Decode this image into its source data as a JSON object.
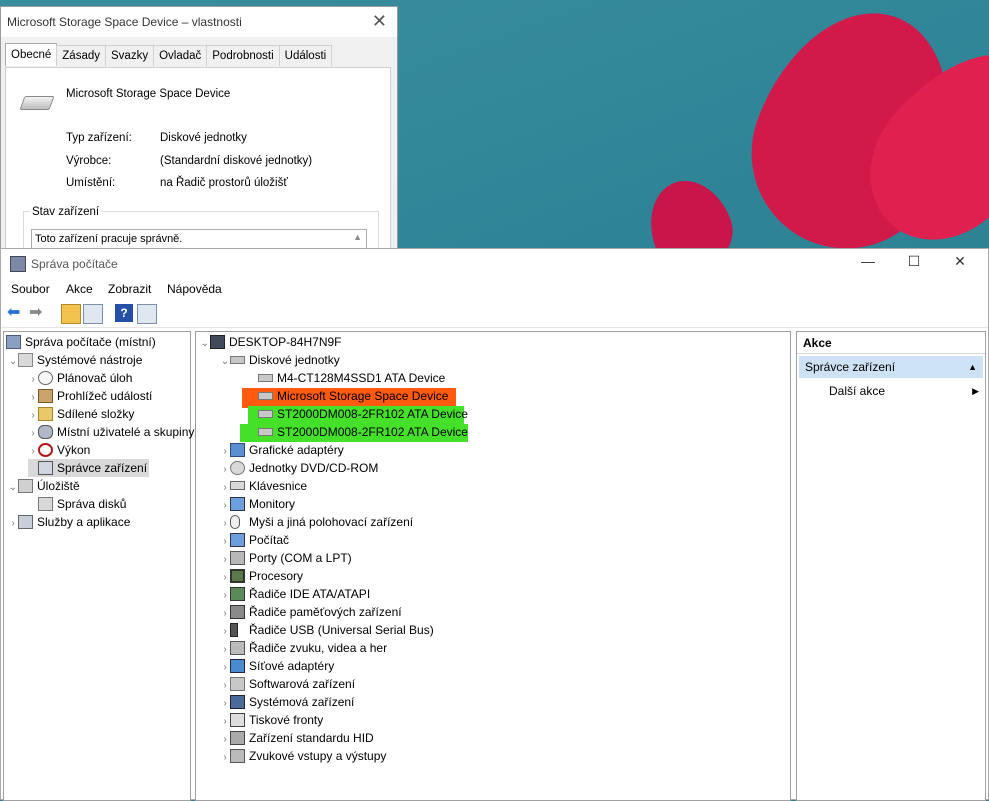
{
  "props_dialog": {
    "title": "Microsoft Storage Space Device – vlastnosti",
    "tabs": [
      "Obecné",
      "Zásady",
      "Svazky",
      "Ovladač",
      "Podrobnosti",
      "Události"
    ],
    "device_name": "Microsoft Storage Space Device",
    "fields": [
      {
        "label": "Typ zařízení:",
        "value": "Diskové jednotky"
      },
      {
        "label": "Výrobce:",
        "value": "(Standardní diskové jednotky)"
      },
      {
        "label": "Umístění:",
        "value": "na Řadič prostorů úložišť"
      }
    ],
    "status_group": "Stav zařízení",
    "status_text": "Toto zařízení pracuje správně."
  },
  "main_window": {
    "title": "Správa počítače",
    "menu": [
      "Soubor",
      "Akce",
      "Zobrazit",
      "Nápověda"
    ]
  },
  "left_tree": [
    {
      "label": "Správa počítače (místní)",
      "icon": "computer-management-icon"
    },
    {
      "label": "Systémové nástroje",
      "icon": "tools-icon"
    },
    {
      "label": "Plánovač úloh",
      "icon": "clock-icon"
    },
    {
      "label": "Prohlížeč událostí",
      "icon": "event-viewer-icon"
    },
    {
      "label": "Sdílené složky",
      "icon": "shared-folder-icon"
    },
    {
      "label": "Místní uživatelé a skupiny",
      "icon": "users-icon"
    },
    {
      "label": "Výkon",
      "icon": "performance-icon"
    },
    {
      "label": "Správce zařízení",
      "icon": "device-manager-icon"
    },
    {
      "label": "Úložiště",
      "icon": "storage-icon"
    },
    {
      "label": "Správa disků",
      "icon": "disk-management-icon"
    },
    {
      "label": "Služby a aplikace",
      "icon": "services-icon"
    }
  ],
  "device_tree": {
    "root": "DESKTOP-84H7N9F",
    "disk_group": "Diskové jednotky",
    "disks": [
      "M4-CT128M4SSD1 ATA Device",
      "Microsoft Storage Space Device",
      "ST2000DM008-2FR102 ATA Device",
      "ST2000DM008-2FR102 ATA Device"
    ],
    "categories": [
      "Grafické adaptéry",
      "Jednotky DVD/CD-ROM",
      "Klávesnice",
      "Monitory",
      "Myši a jiná polohovací zařízení",
      "Počítač",
      "Porty (COM a LPT)",
      "Procesory",
      "Řadiče IDE ATA/ATAPI",
      "Řadiče paměťových zařízení",
      "Řadiče USB (Universal Serial Bus)",
      "Řadiče zvuku, videa a her",
      "Síťové adaptéry",
      "Softwarová zařízení",
      "Systémová zařízení",
      "Tiskové fronty",
      "Zařízení standardu HID",
      "Zvukové vstupy a výstupy"
    ]
  },
  "actions_pane": {
    "header": "Akce",
    "selected": "Správce zařízení",
    "more": "Další akce"
  },
  "colors": {
    "highlight_orange": "#ff5a0f",
    "highlight_green": "#44e02a",
    "selection_blue": "#cde2f5"
  }
}
